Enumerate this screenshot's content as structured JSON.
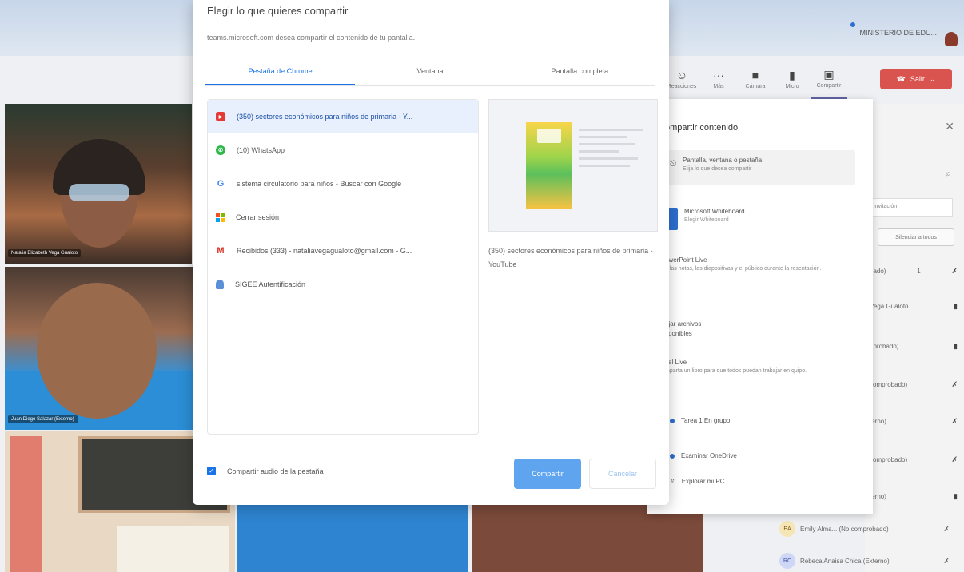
{
  "teams": {
    "org_name": "MINISTERIO DE EDU...",
    "toolbar": [
      {
        "label": "Reacciones",
        "icon": "smile"
      },
      {
        "label": "Más",
        "icon": "more"
      },
      {
        "label": "Cámara",
        "icon": "camera"
      },
      {
        "label": "Micro",
        "icon": "mic"
      },
      {
        "label": "Compartir",
        "icon": "share"
      }
    ],
    "leave_label": "Salir",
    "tiles": [
      {
        "name": "Natalia Elizabeth Vega Gualoto"
      },
      {
        "name": "Juan Diego Salazar (Externo)"
      }
    ]
  },
  "people_panel": {
    "invite_placeholder": "invitación",
    "mute_all": "Silenciar a todos",
    "rows": [
      {
        "text": "bado)",
        "count": "1"
      },
      {
        "text": "Vega Gualoto"
      },
      {
        "text": "nprobado)"
      },
      {
        "text": "comprobado)"
      },
      {
        "text": "terno)"
      },
      {
        "text": "comprobado)"
      },
      {
        "text": "terno)"
      }
    ],
    "footer": [
      {
        "initials": "EA",
        "text": "Emily Alma... (No comprobado)"
      },
      {
        "initials": "RC",
        "text": "Rebeca Anaisa Chica (Externo)"
      }
    ]
  },
  "share_panel": {
    "title": "ompartir contenido",
    "screen_box": {
      "title": "Pantalla, ventana o pestaña",
      "sub": "Elija lo que desea compartir"
    },
    "whiteboard": {
      "title": "Microsoft Whiteboard",
      "sub": "Elegir Whiteboard"
    },
    "powerpoint": {
      "title": "owerPoint Live",
      "sub": "e las notas, las diapositivas y el público durante la resentación."
    },
    "browse": {
      "title": "ojar archivos",
      "sub": "sponibles"
    },
    "excel": {
      "title": "cel Live",
      "sub": "mparta un libro para que todos puedan trabajar en quipo."
    },
    "links": [
      "Tarea 1 En grupo",
      "Examinar OneDrive",
      "Explorar mi PC"
    ]
  },
  "dialog": {
    "title": "Elegir lo que quieres compartir",
    "subtitle": "teams.microsoft.com desea compartir el contenido de tu pantalla.",
    "tabs": [
      "Pestaña de Chrome",
      "Ventana",
      "Pantalla completa"
    ],
    "active_tab": 0,
    "items": [
      {
        "icon": "youtube",
        "label": "(350) sectores económicos para niños de primaria - Y..."
      },
      {
        "icon": "whatsapp",
        "label": "(10) WhatsApp"
      },
      {
        "icon": "google",
        "label": "sistema circulatorio para niños - Buscar con Google"
      },
      {
        "icon": "microsoft",
        "label": "Cerrar sesión"
      },
      {
        "icon": "gmail",
        "label": "Recibidos (333) - nataliavegagualoto@gmail.com - G..."
      },
      {
        "icon": "sigee",
        "label": "SIGEE Autentificación"
      }
    ],
    "selected_index": 0,
    "preview_caption": "(350) sectores económicos para niños de primaria - YouTube",
    "audio_label": "Compartir audio de la pestaña",
    "share_label": "Compartir",
    "cancel_label": "Cancelar"
  }
}
